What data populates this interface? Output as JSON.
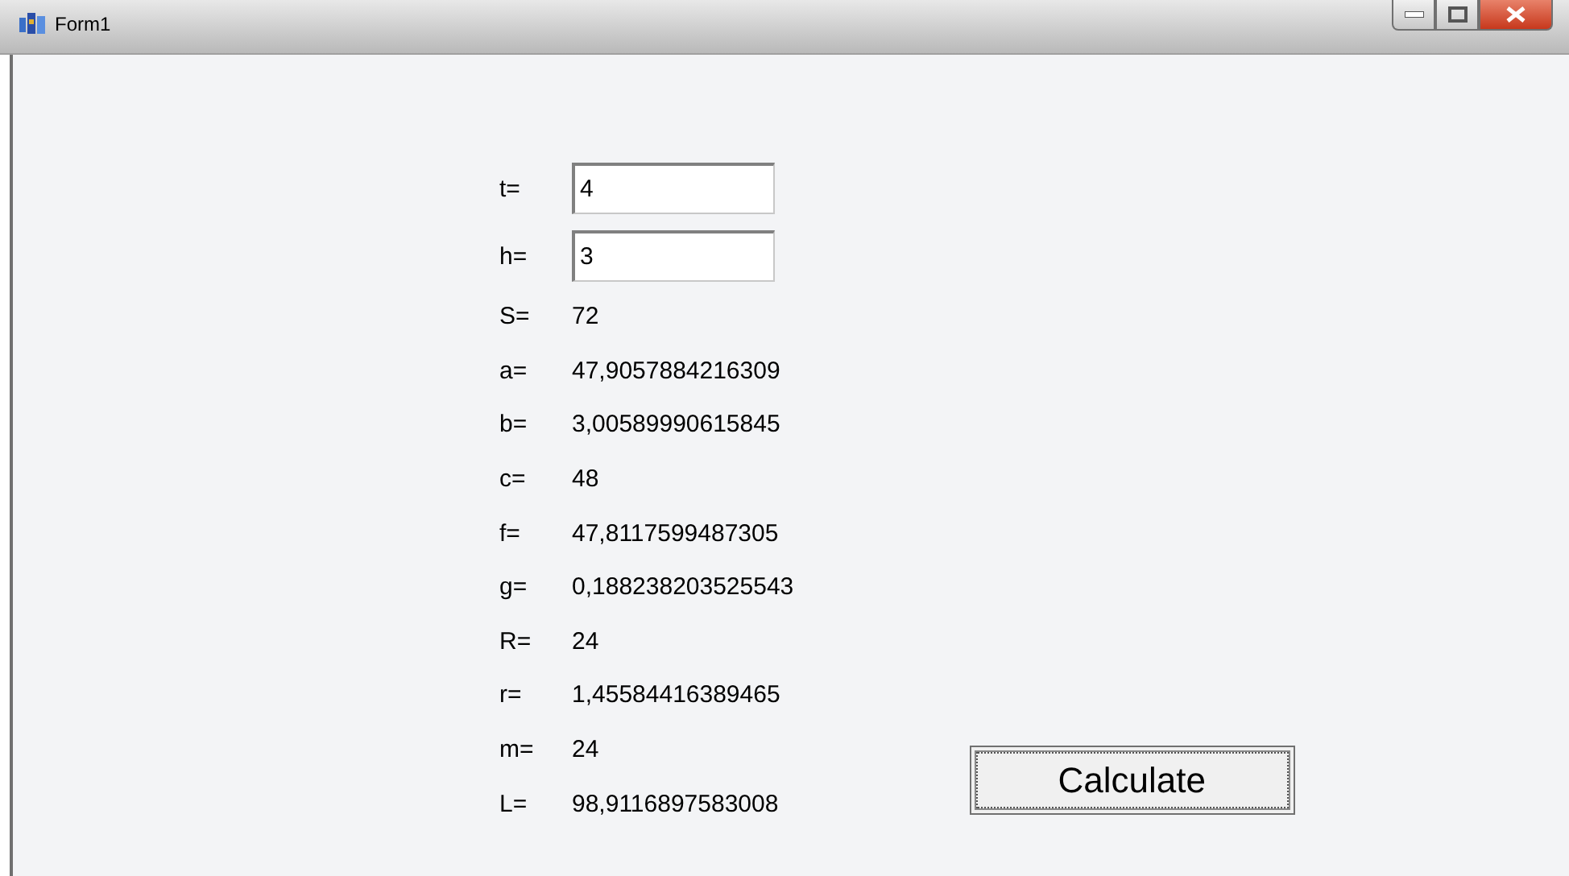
{
  "window": {
    "title": "Form1"
  },
  "rows": [
    {
      "label": "t=",
      "kind": "input",
      "value": "4"
    },
    {
      "label": "h=",
      "kind": "input",
      "value": "3"
    },
    {
      "label": "S=",
      "kind": "output",
      "value": "72"
    },
    {
      "label": "a=",
      "kind": "output",
      "value": "47,9057884216309"
    },
    {
      "label": "b=",
      "kind": "output",
      "value": "3,00589990615845"
    },
    {
      "label": "c=",
      "kind": "output",
      "value": "48"
    },
    {
      "label": "f=",
      "kind": "output",
      "value": "47,8117599487305"
    },
    {
      "label": "g=",
      "kind": "output",
      "value": "0,188238203525543"
    },
    {
      "label": "R=",
      "kind": "output",
      "value": "24"
    },
    {
      "label": "r=",
      "kind": "output",
      "value": "1,45584416389465"
    },
    {
      "label": "m=",
      "kind": "output",
      "value": "24"
    },
    {
      "label": "L=",
      "kind": "output",
      "value": "98,9116897583008"
    }
  ],
  "button": {
    "label": "Calculate"
  }
}
